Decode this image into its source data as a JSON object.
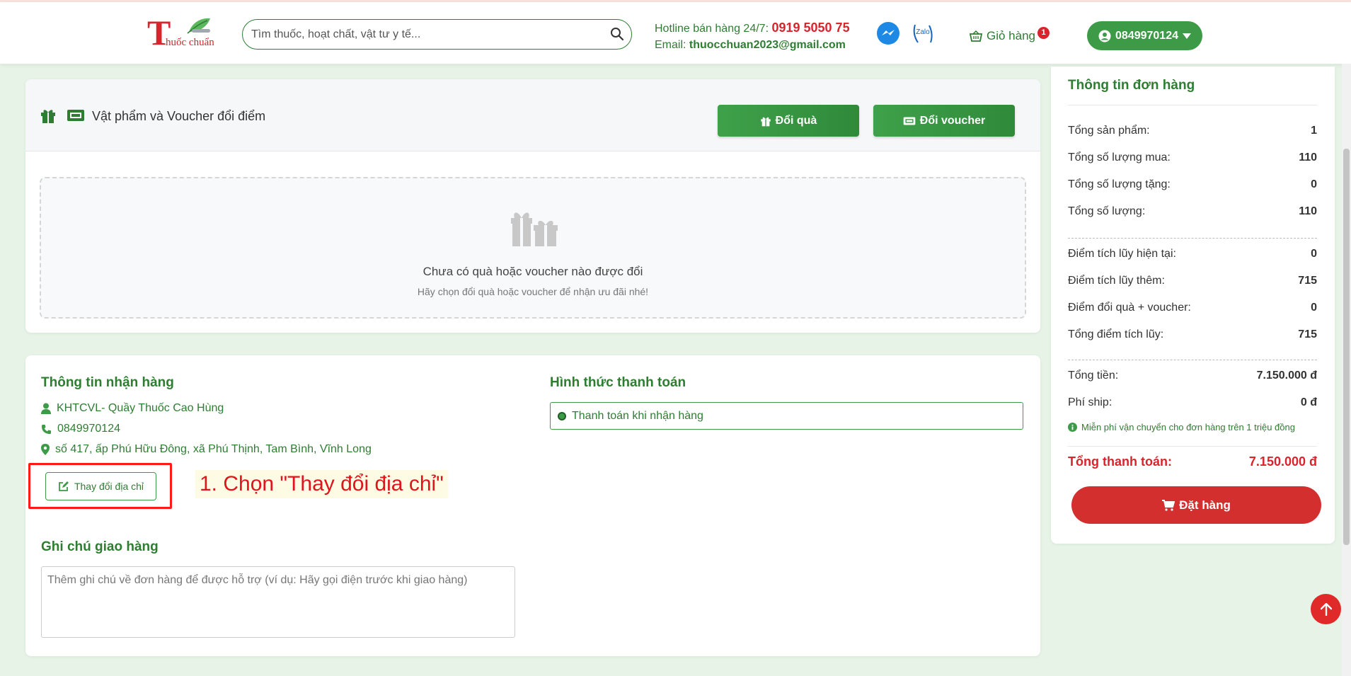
{
  "header": {
    "logo_letter": "T",
    "logo_text": "huốc chuẩn",
    "search_placeholder": "Tìm thuốc, hoạt chất, vật tư y tế...",
    "hotline_label": "Hotline bán hàng 24/7:",
    "hotline_number": "0919 5050 75",
    "email_label": "Email:",
    "email_value": "thuocchuan2023@gmail.com",
    "zalo_label": "Zalo",
    "cart_label": "Giỏ hàng",
    "cart_count": "1",
    "account_label": "0849970124"
  },
  "voucher": {
    "title": "Vật phẩm và Voucher đổi điểm",
    "gift_button": "Đổi quà",
    "voucher_button": "Đổi voucher",
    "empty_title": "Chưa có quà hoặc voucher nào được đổi",
    "empty_sub": "Hãy chọn đổi quà hoặc voucher để nhận ưu đãi nhé!"
  },
  "shipping": {
    "title": "Thông tin nhận hàng",
    "name": "KHTCVL- Quầy Thuốc Cao Hùng",
    "phone": "0849970124",
    "address": "số 417, ấp Phú Hữu Đông, xã Phú Thịnh, Tam Bình, Vĩnh Long",
    "change_address_button": "Thay đổi địa chỉ",
    "annotation": "1. Chọn \"Thay đổi địa chỉ\"",
    "note_title": "Ghi chú giao hàng",
    "note_placeholder": "Thêm ghi chú về đơn hàng để được hỗ trợ (ví dụ: Hãy gọi điện trước khi giao hàng)"
  },
  "payment": {
    "title": "Hình thức thanh toán",
    "option": "Thanh toán khi nhận hàng"
  },
  "order": {
    "title": "Thông tin đơn hàng",
    "rows_qty": [
      {
        "label": "Tổng sản phẩm:",
        "value": "1"
      },
      {
        "label": "Tổng số lượng mua:",
        "value": "110"
      },
      {
        "label": "Tổng số lượng tặng:",
        "value": "0"
      },
      {
        "label": "Tổng số lượng:",
        "value": "110"
      }
    ],
    "rows_points": [
      {
        "label": "Điểm tích lũy hiện tại:",
        "value": "0"
      },
      {
        "label": "Điểm tích lũy thêm:",
        "value": "715"
      },
      {
        "label": "Điểm đổi quà + voucher:",
        "value": "0"
      },
      {
        "label": "Tổng điểm tích lũy:",
        "value": "715"
      }
    ],
    "rows_money": [
      {
        "label": "Tổng tiền:",
        "value": "7.150.000 đ"
      },
      {
        "label": "Phí ship:",
        "value": "0 đ"
      }
    ],
    "free_ship_note": "Miễn phí vận chuyển cho đơn hàng trên 1 triệu đồng",
    "total_label": "Tổng thanh toán:",
    "total_value": "7.150.000 đ",
    "order_button": "Đặt hàng"
  },
  "colors": {
    "brand_green": "#2e7d32",
    "accent_red": "#d9232d",
    "background": "#e6f3e6"
  }
}
